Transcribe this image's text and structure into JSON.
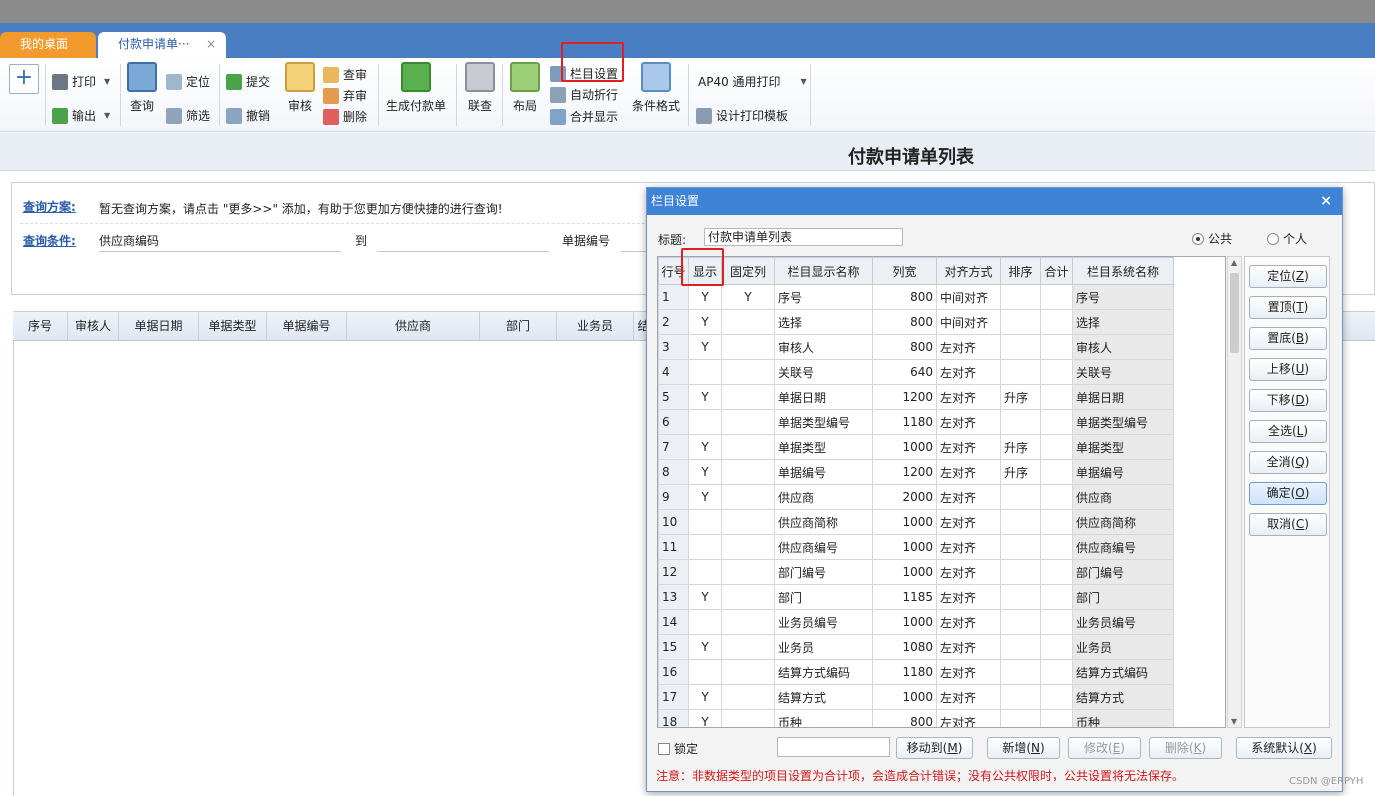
{
  "tabs": {
    "home": "我的桌面",
    "active": "付款申请单···",
    "close": "×"
  },
  "toolbar": {
    "print": "打印",
    "export": "输出",
    "query": "查询",
    "locate": "定位",
    "filter": "筛选",
    "submit": "提交",
    "revoke": "撤销",
    "audit": "审核",
    "review": "查审",
    "abandon": "弃审",
    "delete": "删除",
    "gen_payment": "生成付款单",
    "link_query": "联查",
    "layout": "布局",
    "column_settings": "栏目设置",
    "auto_wrap": "自动折行",
    "merge_display": "合并显示",
    "cond_format": "条件格式",
    "print_template": "AP40 通用打印",
    "design_template": "设计打印模板"
  },
  "page": {
    "title": "付款申请单列表"
  },
  "query": {
    "scheme_label": "查询方案:",
    "scheme_hint": "暂无查询方案，请点击 \"更多>>\" 添加，有助于您更加方便快捷的进行查询!",
    "cond_label": "查询条件:",
    "supplier_code": "供应商编码",
    "to": "到",
    "doc_no": "单据编号"
  },
  "grid": {
    "columns": [
      "序号",
      "审核人",
      "单据日期",
      "单据类型",
      "单据编号",
      "供应商",
      "部门",
      "业务员",
      "结"
    ]
  },
  "dialog": {
    "title": "栏目设置",
    "close": "×",
    "title_label": "标题:",
    "title_value": "付款申请单列表",
    "radio_public": "公共",
    "radio_personal": "个人",
    "headers": [
      "行号",
      "显示",
      "固定列",
      "栏目显示名称",
      "列宽",
      "对齐方式",
      "排序",
      "合计",
      "栏目系统名称"
    ],
    "rows": [
      {
        "no": "1",
        "show": "Y",
        "fixed": "Y",
        "name": "序号",
        "width": "800",
        "align": "中间对齐",
        "sort": "",
        "sum": "",
        "sys": "序号"
      },
      {
        "no": "2",
        "show": "Y",
        "fixed": "",
        "name": "选择",
        "width": "800",
        "align": "中间对齐",
        "sort": "",
        "sum": "",
        "sys": "选择"
      },
      {
        "no": "3",
        "show": "Y",
        "fixed": "",
        "name": "审核人",
        "width": "800",
        "align": "左对齐",
        "sort": "",
        "sum": "",
        "sys": "审核人"
      },
      {
        "no": "4",
        "show": "",
        "fixed": "",
        "name": "关联号",
        "width": "640",
        "align": "左对齐",
        "sort": "",
        "sum": "",
        "sys": "关联号"
      },
      {
        "no": "5",
        "show": "Y",
        "fixed": "",
        "name": "单据日期",
        "width": "1200",
        "align": "左对齐",
        "sort": "升序",
        "sum": "",
        "sys": "单据日期"
      },
      {
        "no": "6",
        "show": "",
        "fixed": "",
        "name": "单据类型编号",
        "width": "1180",
        "align": "左对齐",
        "sort": "",
        "sum": "",
        "sys": "单据类型编号"
      },
      {
        "no": "7",
        "show": "Y",
        "fixed": "",
        "name": "单据类型",
        "width": "1000",
        "align": "左对齐",
        "sort": "升序",
        "sum": "",
        "sys": "单据类型"
      },
      {
        "no": "8",
        "show": "Y",
        "fixed": "",
        "name": "单据编号",
        "width": "1200",
        "align": "左对齐",
        "sort": "升序",
        "sum": "",
        "sys": "单据编号"
      },
      {
        "no": "9",
        "show": "Y",
        "fixed": "",
        "name": "供应商",
        "width": "2000",
        "align": "左对齐",
        "sort": "",
        "sum": "",
        "sys": "供应商"
      },
      {
        "no": "10",
        "show": "",
        "fixed": "",
        "name": "供应商简称",
        "width": "1000",
        "align": "左对齐",
        "sort": "",
        "sum": "",
        "sys": "供应商简称"
      },
      {
        "no": "11",
        "show": "",
        "fixed": "",
        "name": "供应商编号",
        "width": "1000",
        "align": "左对齐",
        "sort": "",
        "sum": "",
        "sys": "供应商编号"
      },
      {
        "no": "12",
        "show": "",
        "fixed": "",
        "name": "部门编号",
        "width": "1000",
        "align": "左对齐",
        "sort": "",
        "sum": "",
        "sys": "部门编号"
      },
      {
        "no": "13",
        "show": "Y",
        "fixed": "",
        "name": "部门",
        "width": "1185",
        "align": "左对齐",
        "sort": "",
        "sum": "",
        "sys": "部门"
      },
      {
        "no": "14",
        "show": "",
        "fixed": "",
        "name": "业务员编号",
        "width": "1000",
        "align": "左对齐",
        "sort": "",
        "sum": "",
        "sys": "业务员编号"
      },
      {
        "no": "15",
        "show": "Y",
        "fixed": "",
        "name": "业务员",
        "width": "1080",
        "align": "左对齐",
        "sort": "",
        "sum": "",
        "sys": "业务员"
      },
      {
        "no": "16",
        "show": "",
        "fixed": "",
        "name": "结算方式编码",
        "width": "1180",
        "align": "左对齐",
        "sort": "",
        "sum": "",
        "sys": "结算方式编码"
      },
      {
        "no": "17",
        "show": "Y",
        "fixed": "",
        "name": "结算方式",
        "width": "1000",
        "align": "左对齐",
        "sort": "",
        "sum": "",
        "sys": "结算方式"
      },
      {
        "no": "18",
        "show": "Y",
        "fixed": "",
        "name": "币种",
        "width": "800",
        "align": "左对齐",
        "sort": "",
        "sum": "",
        "sys": "币种"
      }
    ],
    "side_buttons": {
      "locate": "定位",
      "locate_key": "Z",
      "top": "置顶",
      "top_key": "T",
      "bottom": "置底",
      "bottom_key": "B",
      "up": "上移",
      "up_key": "U",
      "down": "下移",
      "down_key": "D",
      "select_all": "全选",
      "select_all_key": "L",
      "clear_all": "全消",
      "clear_all_key": "Q",
      "ok": "确定",
      "ok_key": "O",
      "cancel": "取消",
      "cancel_key": "C"
    },
    "lock_label": "锁定",
    "move_to": "移动到",
    "move_to_key": "M",
    "add": "新增",
    "add_key": "N",
    "modify": "修改",
    "modify_key": "E",
    "remove": "删除",
    "remove_key": "K",
    "sys_default": "系统默认",
    "sys_default_key": "X",
    "note": "注意：非数据类型的项目设置为合计项，会造成合计错误；没有公共权限时，公共设置将无法保存。"
  },
  "watermark": "CSDN @ERPYH"
}
